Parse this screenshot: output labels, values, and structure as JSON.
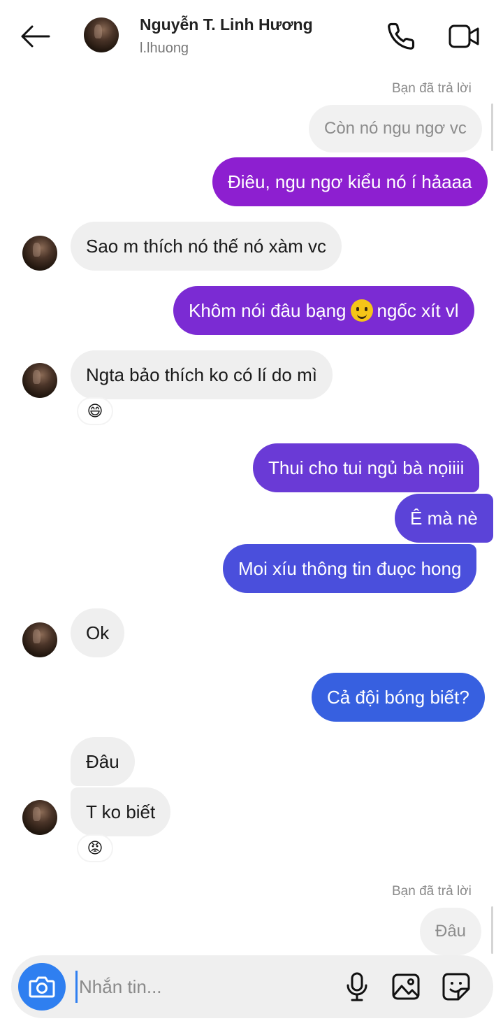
{
  "header": {
    "contact_name": "Nguyễn T. Linh Hương",
    "username": "l.lhuong",
    "icons": {
      "back": "arrow-left-icon",
      "call": "phone-icon",
      "video": "video-camera-icon"
    }
  },
  "messages": [
    {
      "type": "reply_label",
      "text": "Bạn đã trả lời"
    },
    {
      "type": "quoted",
      "text": "Còn nó ngu ngơ vc"
    },
    {
      "type": "out",
      "text": "Điêu, ngu ngơ kiểu nó í hảaaa",
      "color": "#8d1fd0"
    },
    {
      "type": "in",
      "text": "Sao m thích nó thế nó xàm vc"
    },
    {
      "type": "out",
      "text_before": "Khôm nói đâu bạng",
      "emoji": "smiling-face-with-tear-icon",
      "text_after": "ngốc xít vl",
      "color": "#7b2bd3"
    },
    {
      "type": "in",
      "text": "Ngta bảo thích ko có lí do mì",
      "reaction": "😄"
    },
    {
      "type": "out",
      "text": "Thui cho tui ngủ bà nọiiii",
      "color": "#6a3ad6"
    },
    {
      "type": "out",
      "text": "Ê mà nè",
      "color": "#5b43d8"
    },
    {
      "type": "out",
      "text": "Moi xíu thông tin đuọc hong",
      "color": "#4a4fdc"
    },
    {
      "type": "in",
      "text": "Ok"
    },
    {
      "type": "out",
      "text": "Cả đội bóng biết?",
      "color": "#3760e0"
    },
    {
      "type": "in",
      "text": "Đâu"
    },
    {
      "type": "in",
      "text": "T ko biết",
      "reaction": "😡"
    },
    {
      "type": "reply_label",
      "text": "Bạn đã trả lời"
    },
    {
      "type": "quoted",
      "text": "Đâu"
    }
  ],
  "composer": {
    "placeholder": "Nhắn tin...",
    "icons": {
      "camera": "camera-icon",
      "mic": "microphone-icon",
      "gallery": "image-icon",
      "sticker": "sticker-icon"
    },
    "accent": "#2f7ff0"
  }
}
